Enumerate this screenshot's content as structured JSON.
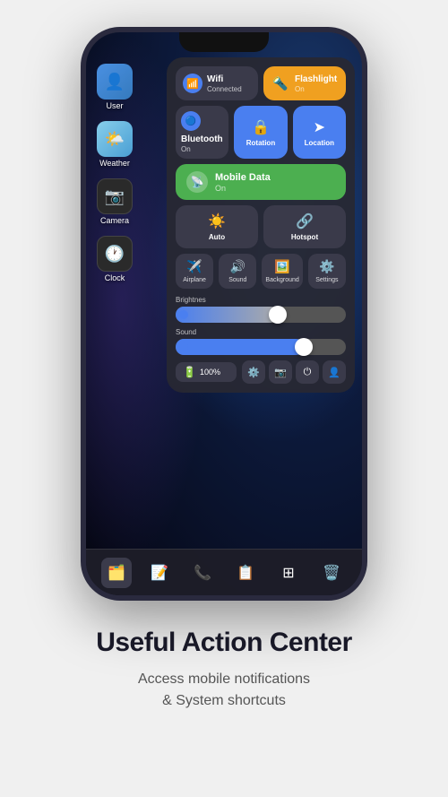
{
  "phone": {
    "apps": [
      {
        "id": "user",
        "label": "User",
        "icon": "👤",
        "class": "icon-user"
      },
      {
        "id": "weather",
        "label": "Weather",
        "icon": "🌤️",
        "class": "icon-weather"
      },
      {
        "id": "camera",
        "label": "Camera",
        "icon": "📷",
        "class": "icon-camera"
      },
      {
        "id": "clock",
        "label": "Clock",
        "icon": "🕐",
        "class": "icon-clock"
      }
    ],
    "control_center": {
      "wifi": {
        "name": "Wifi",
        "status": "Connected"
      },
      "flashlight": {
        "name": "Flashlight",
        "status": "On"
      },
      "bluetooth": {
        "name": "Bluetooth",
        "status": "On"
      },
      "rotation": {
        "name": "Rotation"
      },
      "location": {
        "name": "Location"
      },
      "mobile_data": {
        "name": "Mobile Data",
        "status": "On"
      },
      "auto": {
        "name": "Auto"
      },
      "hotspot": {
        "name": "Hotspot"
      },
      "airplane": {
        "name": "Airplane"
      },
      "sound": {
        "name": "Sound"
      },
      "background": {
        "name": "Background"
      },
      "settings": {
        "name": "Settings"
      },
      "brightness_label": "Brightnes",
      "sound_label": "Sound",
      "battery_percent": "100%"
    },
    "dock_items": [
      "finder",
      "font",
      "phone",
      "notes",
      "switch",
      "trash"
    ]
  },
  "page": {
    "title": "Useful Action Center",
    "subtitle": "Access mobile notifications\n& System shortcuts"
  }
}
